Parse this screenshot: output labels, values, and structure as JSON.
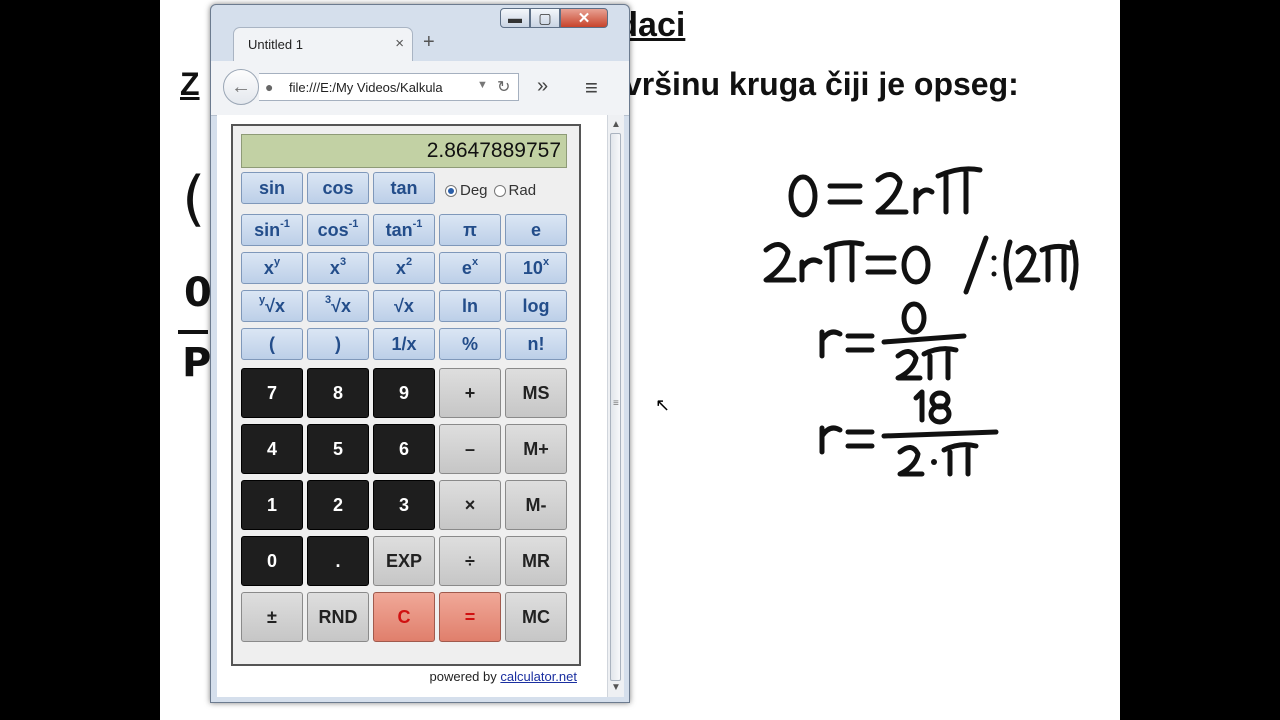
{
  "slide": {
    "title_visible": "ina kruga - zadaci",
    "subtitle_left": "Z",
    "subtitle_right": "vršinu kruga čiji je opseg:",
    "left_fragments": [
      "(",
      "0",
      "P"
    ]
  },
  "browser": {
    "tab_title": "Untitled 1",
    "url": "file:///E:/My Videos/Kalkula",
    "window_buttons": {
      "minimize": "▬",
      "maximize": "▢",
      "close": "✕"
    },
    "new_tab": "+",
    "tab_close": "×",
    "overflow": "»",
    "menu": "≡"
  },
  "calculator": {
    "display": "2.8647889757",
    "mode_deg": "Deg",
    "mode_rad": "Rad",
    "keys": {
      "sin": "sin",
      "cos": "cos",
      "tan": "tan",
      "pi": "π",
      "e": "e",
      "ln": "ln",
      "log": "log",
      "recip": "1/x",
      "percent": "%",
      "fact": "n!",
      "lparen": "(",
      "rparen": ")",
      "d7": "7",
      "d8": "8",
      "d9": "9",
      "plus": "+",
      "ms": "MS",
      "d4": "4",
      "d5": "5",
      "d6": "6",
      "minus": "–",
      "mplus": "M+",
      "d1": "1",
      "d2": "2",
      "d3": "3",
      "times": "×",
      "mminus": "M-",
      "d0": "0",
      "dot": ".",
      "exp": "EXP",
      "div": "÷",
      "mr": "MR",
      "pm": "±",
      "rnd": "RND",
      "clear": "C",
      "equals": "=",
      "mc": "MC"
    },
    "sup_keys": {
      "asin_base": "sin",
      "acos_base": "cos",
      "atan_base": "tan",
      "inv_exp": "-1",
      "xy_base": "x",
      "xy_exp": "y",
      "x3_base": "x",
      "x3_exp": "3",
      "x2_base": "x",
      "x2_exp": "2",
      "ex_base": "e",
      "ex_exp": "x",
      "tenx_base": "10",
      "tenx_exp": "x",
      "yroot_pre": "y",
      "yroot_base": "√x",
      "cbrt_pre": "3",
      "cbrt_base": "√x",
      "sqrt": "√x"
    },
    "powered_by": "powered by",
    "powered_link": "calculator.net"
  }
}
